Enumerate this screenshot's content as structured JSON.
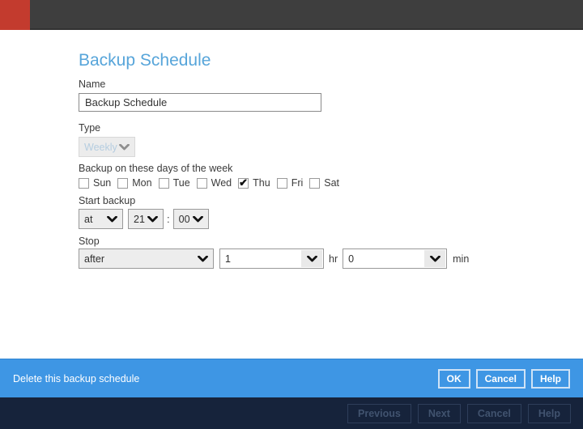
{
  "colors": {
    "topbar": "#3e3e3e",
    "logo_red": "#c33b2e",
    "title_blue": "#57a5da",
    "action_bar_blue": "#3e96e4",
    "footer_navy": "#16233b"
  },
  "dialog": {
    "title": "Backup Schedule",
    "name_field": {
      "label": "Name",
      "value": "Backup Schedule"
    },
    "type_field": {
      "label": "Type",
      "value": "Weekly",
      "disabled": true
    },
    "days": {
      "label": "Backup on these days of the week",
      "items": [
        {
          "label": "Sun",
          "checked": false
        },
        {
          "label": "Mon",
          "checked": false
        },
        {
          "label": "Tue",
          "checked": false
        },
        {
          "label": "Wed",
          "checked": false
        },
        {
          "label": "Thu",
          "checked": true
        },
        {
          "label": "Fri",
          "checked": false
        },
        {
          "label": "Sat",
          "checked": false
        }
      ]
    },
    "start": {
      "label": "Start backup",
      "mode": "at",
      "hour": "21",
      "separator": ":",
      "minute": "00"
    },
    "stop": {
      "label": "Stop",
      "mode": "after",
      "hours": "1",
      "hr_unit": "hr",
      "minutes": "0",
      "min_unit": "min"
    }
  },
  "action_bar": {
    "delete_link": "Delete this backup schedule",
    "ok_label": "OK",
    "cancel_label": "Cancel",
    "help_label": "Help"
  },
  "footer": {
    "previous_label": "Previous",
    "next_label": "Next",
    "cancel_label": "Cancel",
    "help_label": "Help"
  }
}
